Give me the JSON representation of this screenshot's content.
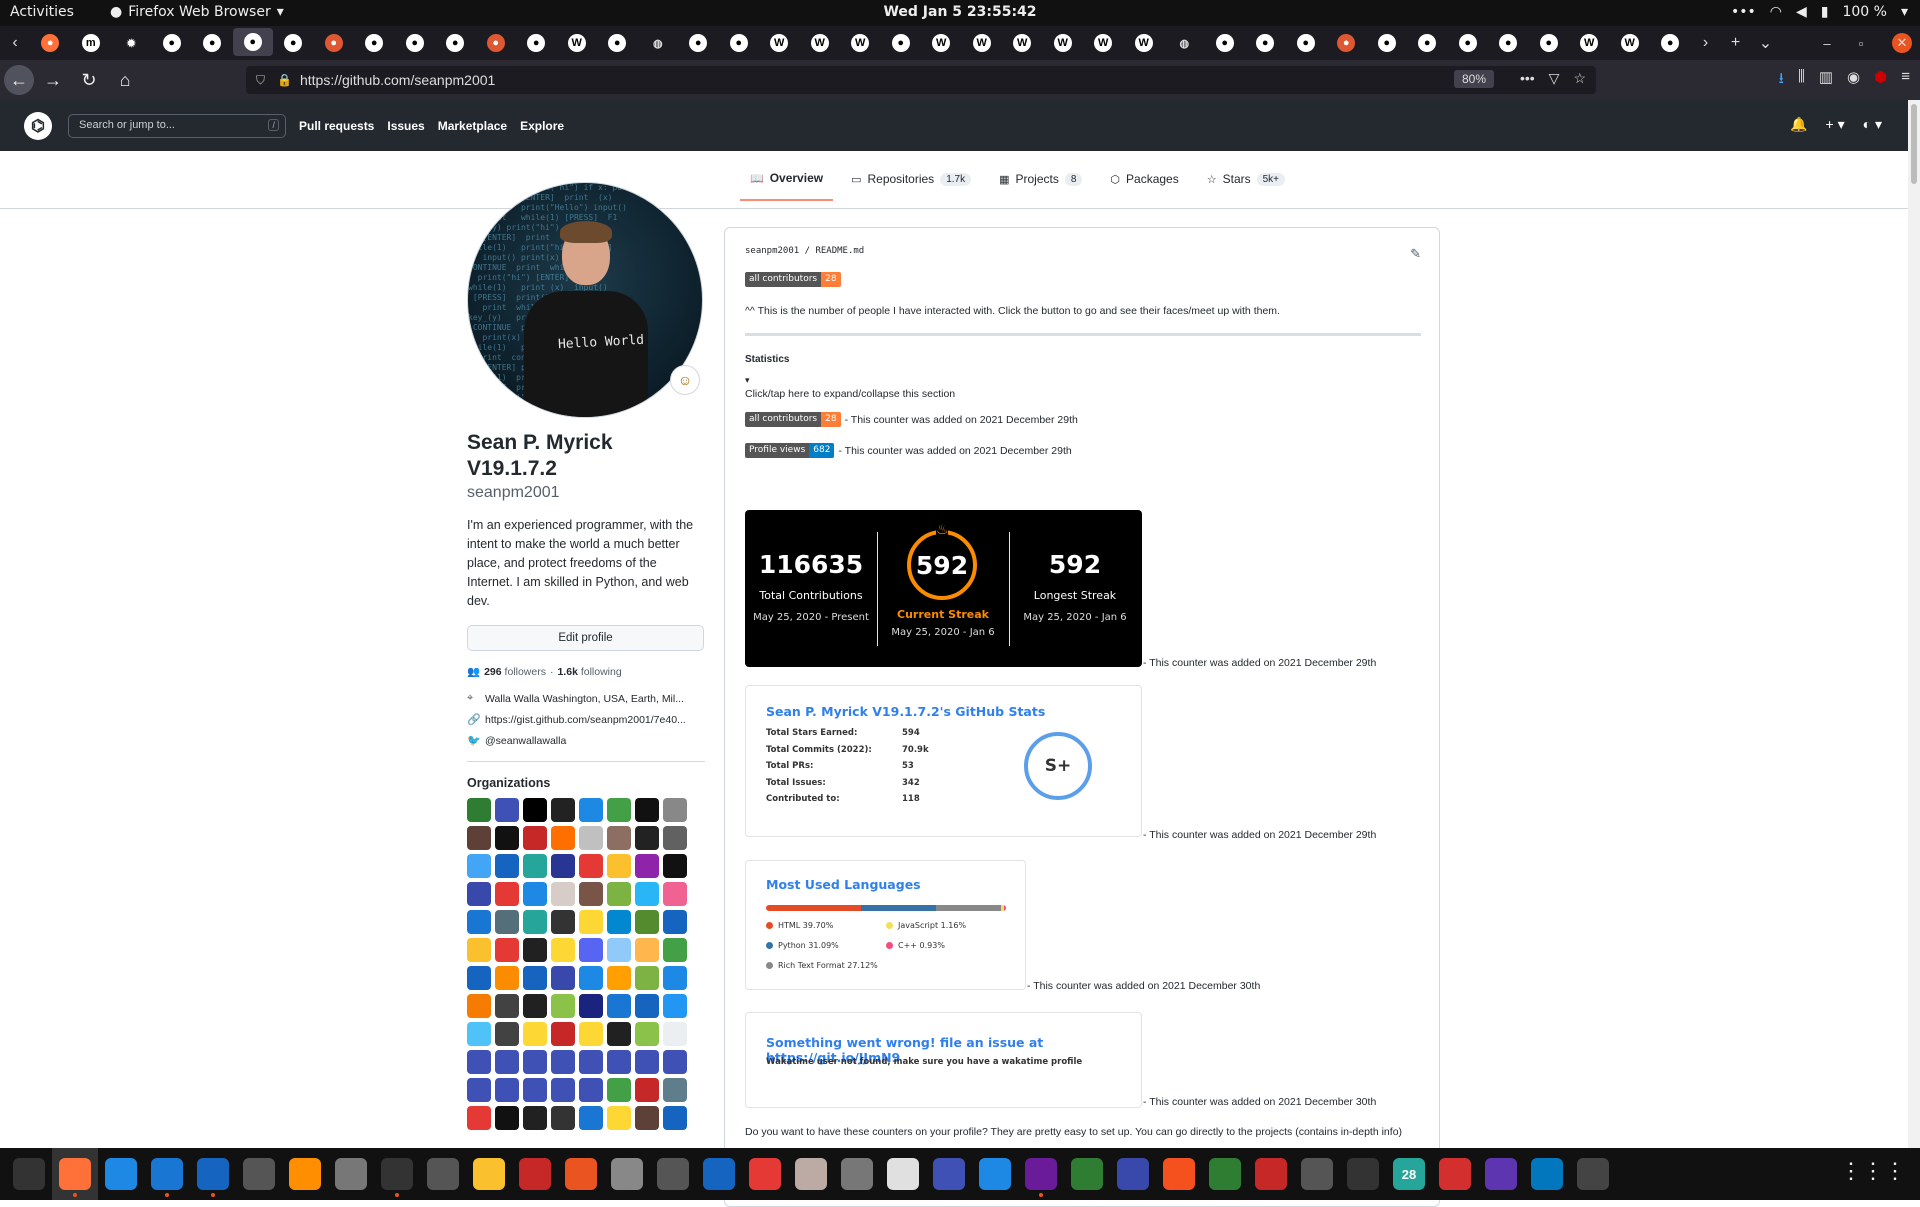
{
  "gnome": {
    "activities": "Activities",
    "app_name": "Firefox Web Browser",
    "clock": "Wed Jan 5  23:55:42",
    "battery": "100 %"
  },
  "tabs": [
    "firefox",
    "m",
    "gear",
    "github",
    "github",
    "github",
    "github",
    "duck",
    "github",
    "github",
    "github",
    "duck",
    "github",
    "wiki",
    "github",
    "globe",
    "github",
    "github",
    "wiki",
    "wiki",
    "wiki",
    "github",
    "wiki",
    "wiki",
    "wiki",
    "wiki",
    "wiki",
    "wiki",
    "globe",
    "github",
    "github",
    "github",
    "duck",
    "github",
    "github",
    "github",
    "github",
    "github",
    "wiki",
    "wiki",
    "github"
  ],
  "toolbar": {
    "url": "https://github.com/seanpm2001",
    "zoom": "80%"
  },
  "gh_header": {
    "search_placeholder": "Search or jump to...",
    "slash": "/",
    "nav": [
      "Pull requests",
      "Issues",
      "Marketplace",
      "Explore"
    ]
  },
  "profile_tabs": [
    {
      "label": "Overview",
      "count": "",
      "icon": "book-icon"
    },
    {
      "label": "Repositories",
      "count": "1.7k",
      "icon": "repo-icon"
    },
    {
      "label": "Projects",
      "count": "8",
      "icon": "project-icon"
    },
    {
      "label": "Packages",
      "count": "",
      "icon": "package-icon"
    },
    {
      "label": "Stars",
      "count": "5k+",
      "icon": "star-icon"
    }
  ],
  "profile": {
    "name": "Sean P. Myrick V19.1.7.2",
    "login": "seanpm2001",
    "bio": "I'm an experienced programmer, with the intent to make the world a much better place, and protect freedoms of the Internet. I am skilled in Python, and web dev.",
    "edit_label": "Edit profile",
    "followers_count": "296",
    "followers_label": "followers",
    "dot": "·",
    "following_count": "1.6k",
    "following_label": "following",
    "location": "Walla Walla Washington, USA, Earth, Mil...",
    "website": "https://gist.github.com/seanpm2001/7e40...",
    "twitter": "@seanwallawalla",
    "organizations_title": "Organizations",
    "shirt_text": "Hello World"
  },
  "readme": {
    "path_owner": "seanpm2001",
    "path_sep": " / ",
    "path_file": "README.md",
    "badge_label": "all contributors",
    "badge_value": "28",
    "intro": "^^ This is the number of people I have interacted with. Click the button to go and see their faces/meet up with them.",
    "stats_heading": "Statistics",
    "toggle_arrow": "▾",
    "toggle_text": "Click/tap here to expand/collapse this section",
    "counter_note_1": "- This counter was added on 2021 December 29th",
    "views_label": "Profile views",
    "views_value": "682",
    "counter_note_2": "- This counter was added on 2021 December 29th",
    "streak_note": "- This counter was added on 2021 December 29th",
    "stats_note": "- This counter was added on 2021 December 29th",
    "lang_note": "- This counter was added on 2021 December 30th",
    "waka_note": "- This counter was added on 2021 December 30th",
    "footer": "Do you want to have these counters on your profile? They are pretty easy to set up. You can go directly to the projects (contains in-depth info)"
  },
  "streak": {
    "total": "116635",
    "total_label": "Total Contributions",
    "total_range": "May 25, 2020 - Present",
    "current": "592",
    "current_label": "Current Streak",
    "current_range": "May 25, 2020 - Jan 6",
    "longest": "592",
    "longest_label": "Longest Streak",
    "longest_range": "May 25, 2020 - Jan 6"
  },
  "stats": {
    "title": "Sean P. Myrick V19.1.7.2's GitHub Stats",
    "rows": [
      {
        "label": "Total Stars Earned:",
        "value": "594"
      },
      {
        "label": "Total Commits (2022):",
        "value": "70.9k"
      },
      {
        "label": "Total PRs:",
        "value": "53"
      },
      {
        "label": "Total Issues:",
        "value": "342"
      },
      {
        "label": "Contributed to:",
        "value": "118"
      }
    ],
    "rank": "S+"
  },
  "languages": {
    "title": "Most Used Languages",
    "items": [
      {
        "name": "HTML 39.70%",
        "color": "#e34c26",
        "pct": 39.7
      },
      {
        "name": "Python 31.09%",
        "color": "#3572A5",
        "pct": 31.09
      },
      {
        "name": "Rich Text Format 27.12%",
        "color": "#888888",
        "pct": 27.12
      },
      {
        "name": "JavaScript 1.16%",
        "color": "#f1e05a",
        "pct": 1.16
      },
      {
        "name": "C++ 0.93%",
        "color": "#f34b7d",
        "pct": 0.93
      }
    ]
  },
  "waka": {
    "title": "Something went wrong! file an issue at https://git.io/JJmN9",
    "message": "Wakatime user not found, make sure you have a wakatime profile"
  },
  "dock": [
    "monitor",
    "firefox",
    "text-editor",
    "help",
    "notes",
    "settings",
    "vlc",
    "files",
    "terminal",
    "gimp",
    "slides",
    "graph",
    "store",
    "search",
    "camera",
    "writer",
    "calc-tool",
    "wine",
    "disk",
    "video",
    "scanner",
    "tile",
    "todo",
    "vim",
    "window",
    "update",
    "sheets",
    "mario",
    "bird",
    "music",
    "calendar",
    "error",
    "obs",
    "gecko",
    "apps"
  ],
  "dock_calendar_num": "28",
  "colors": {
    "gh_header": "#24292f",
    "link": "#2f80ed",
    "streak_orange": "#fb8c00",
    "badge_orange": "#fe7d37",
    "badge_blue": "#007ec6"
  }
}
